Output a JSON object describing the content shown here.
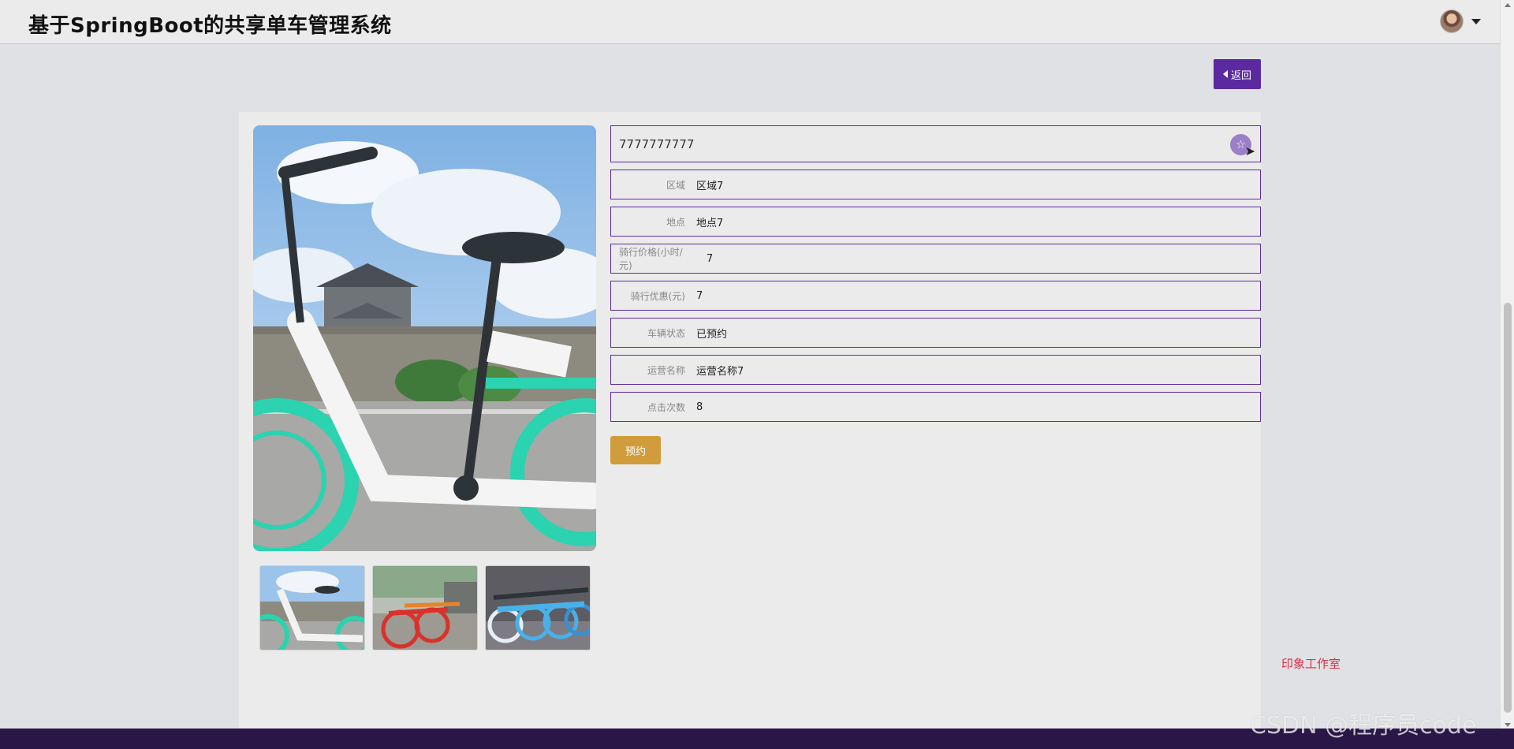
{
  "header": {
    "title": "基于SpringBoot的共享单车管理系统",
    "avatar_icon": "user-avatar",
    "menu_icon": "caret-down-icon"
  },
  "actions": {
    "back_label": "返回",
    "reserve_label": "预约"
  },
  "product": {
    "name": "7777777777",
    "favorite_icon": "star-icon",
    "fields": [
      {
        "label": "区域",
        "value": "区域7"
      },
      {
        "label": "地点",
        "value": "地点7"
      },
      {
        "label": "骑行价格(小时/元)",
        "value": "7"
      },
      {
        "label": "骑行优惠(元)",
        "value": "7"
      },
      {
        "label": "车辆状态",
        "value": "已预约"
      },
      {
        "label": "运营名称",
        "value": "运营名称7"
      },
      {
        "label": "点击次数",
        "value": "8"
      }
    ]
  },
  "images": {
    "main": "bike-photo-main",
    "thumbs": [
      "bike-photo-1",
      "bike-photo-2",
      "bike-photo-3"
    ]
  },
  "sidebar_text": "印象工作室",
  "watermark": "CSDN @程序员code",
  "colors": {
    "accent": "#5b2aa0",
    "reserve": "#d19d3c",
    "footer": "#2a1748",
    "studio_text": "#d9304a"
  }
}
